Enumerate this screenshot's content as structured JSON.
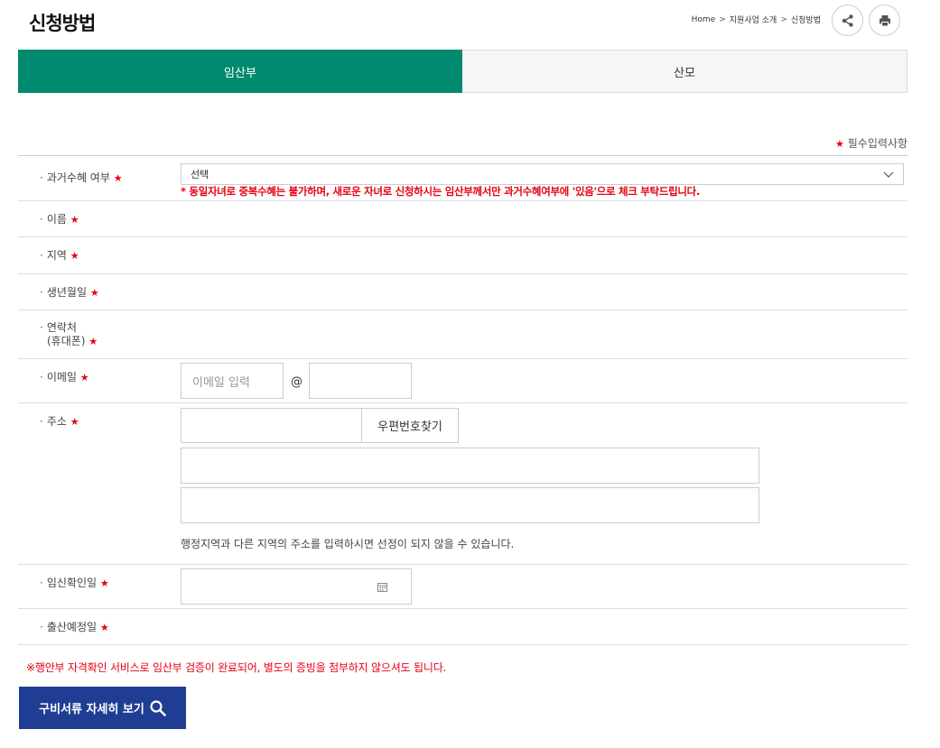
{
  "header": {
    "title": "신청방법",
    "breadcrumb": [
      "Home",
      "지원사업 소개",
      "신청방법"
    ],
    "breadcrumb_sep": ">"
  },
  "tabs": [
    {
      "label": "임산부",
      "active": true
    },
    {
      "label": "산모",
      "active": false
    }
  ],
  "required_note": "필수입력사항",
  "required_mark": "★",
  "form": {
    "past_benefit": {
      "label": "과거수혜 여부",
      "selected": "선택",
      "warning": "* 동일자녀로 중복수혜는 불가하며, 새로운 자녀로 신청하시는 임산부께서만 과거수혜여부에 '있음'으로 체크 부탁드립니다."
    },
    "name": {
      "label": "이름"
    },
    "region": {
      "label": "지역"
    },
    "birthdate": {
      "label": "생년월일"
    },
    "contact": {
      "label_line1": "연락처",
      "label_line2": "(휴대폰)"
    },
    "email": {
      "label": "이메일",
      "placeholder": "이메일 입력",
      "at": "@"
    },
    "address": {
      "label": "주소",
      "zip_button": "우편번호찾기",
      "note": "행정지역과 다른 지역의 주소를 입력하시면 선정이 되지 않을 수 있습니다."
    },
    "pregnancy_date": {
      "label": "임신확인일"
    },
    "due_date": {
      "label": "출산예정일"
    }
  },
  "bottom_note": "※행안부 자격확인 서비스로 임산부 검증이 완료되어, 별도의 증빙을 첨부하지 않으셔도 됩니다.",
  "docs_button": "구비서류 자세히 보기",
  "colors": {
    "tab_active": "#008a6f",
    "required_star": "#e60012",
    "docs_button": "#1f3e93"
  },
  "icons": [
    "share-icon",
    "print-icon",
    "chevron-down-icon",
    "calendar-icon",
    "search-icon"
  ]
}
